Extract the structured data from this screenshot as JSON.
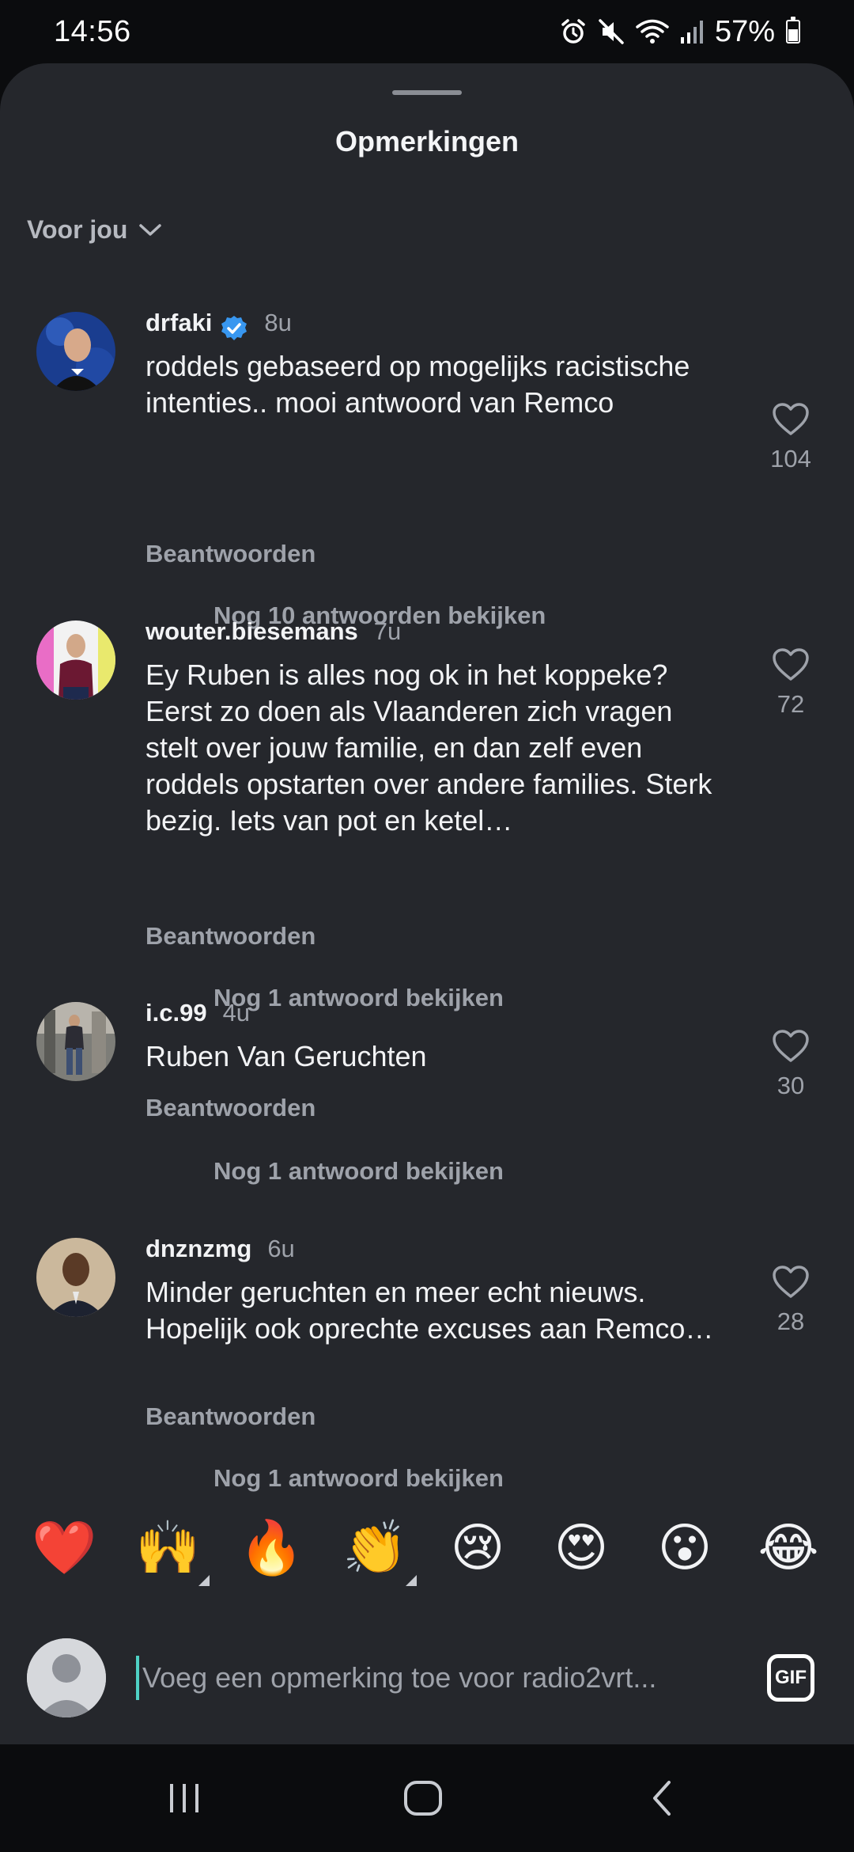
{
  "status_bar": {
    "time": "14:56",
    "battery": "57%",
    "battery_level": 0.57,
    "icons": [
      "alarm-icon",
      "mute-icon",
      "wifi-icon",
      "signal-icon",
      "battery-icon"
    ]
  },
  "sheet": {
    "title": "Opmerkingen",
    "sort_label": "Voor jou"
  },
  "comments": [
    {
      "username": "drfaki",
      "verified": true,
      "time": "8u",
      "text": "roddels gebaseerd op mogelijks racistische intenties.. mooi antwoord van Remco",
      "reply_label": "Beantwoorden",
      "likes": "104",
      "more_replies": "Nog 10 antwoorden bekijken"
    },
    {
      "username": "wouter.biesemans",
      "verified": false,
      "time": "7u",
      "text": "Ey Ruben is alles nog ok in het koppeke? Eerst zo doen als Vlaanderen zich vragen stelt over jouw familie, en dan zelf even roddels opstarten over andere families. Sterk bezig. Iets van pot en ketel…",
      "reply_label": "Beantwoorden",
      "likes": "72",
      "more_replies": "Nog 1 antwoord bekijken"
    },
    {
      "username": "i.c.99",
      "verified": false,
      "time": "4u",
      "text": "Ruben Van Geruchten",
      "reply_label": "Beantwoorden",
      "likes": "30",
      "more_replies": "Nog 1 antwoord bekijken"
    },
    {
      "username": "dnznzmg",
      "verified": false,
      "time": "6u",
      "text": "Minder geruchten en meer echt nieuws. Hopelijk ook oprechte excuses aan Remco…",
      "reply_label": "Beantwoorden",
      "likes": "28",
      "more_replies": "Nog 1 antwoord bekijken"
    }
  ],
  "emoji_bar": [
    "❤️",
    "🙌",
    "🔥",
    "👏",
    "😢",
    "😍",
    "😮",
    "😂"
  ],
  "input": {
    "placeholder": "Voeg een opmerking toe voor radio2vrt...",
    "gif_label": "GIF"
  },
  "colors": {
    "sheet_bg": "#25272c",
    "screen_bg": "#0b0c0e",
    "muted_text": "#9ea2aa",
    "verified_blue": "#3897f0",
    "cursor_teal": "#4fd1c5"
  }
}
